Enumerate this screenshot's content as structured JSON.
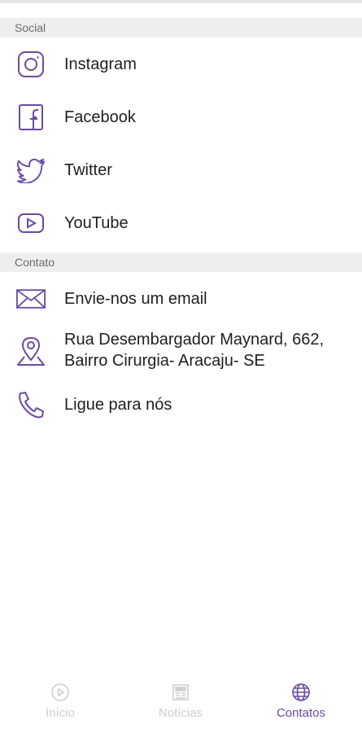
{
  "colors": {
    "accent": "#6a4aa4",
    "icon_stroke": "#6a4aa4",
    "inactive_tab": "#cfcfcf",
    "section_bg": "#eeeeee"
  },
  "social": {
    "header": "Social",
    "items": [
      {
        "label": "Instagram",
        "icon": "instagram-icon"
      },
      {
        "label": "Facebook",
        "icon": "facebook-icon"
      },
      {
        "label": "Twitter",
        "icon": "twitter-icon"
      },
      {
        "label": "YouTube",
        "icon": "youtube-icon"
      }
    ]
  },
  "contact": {
    "header": "Contato",
    "email_label": "Envie-nos um email",
    "address_label": "Rua Desembargador Maynard, 662, Bairro Cirurgia- Aracaju- SE",
    "phone_label": "Ligue para nós"
  },
  "tabs": [
    {
      "label": "Início",
      "icon": "play-circle-icon",
      "active": false
    },
    {
      "label": "Notícias",
      "icon": "newspaper-icon",
      "active": false
    },
    {
      "label": "Contatos",
      "icon": "globe-icon",
      "active": true
    }
  ]
}
